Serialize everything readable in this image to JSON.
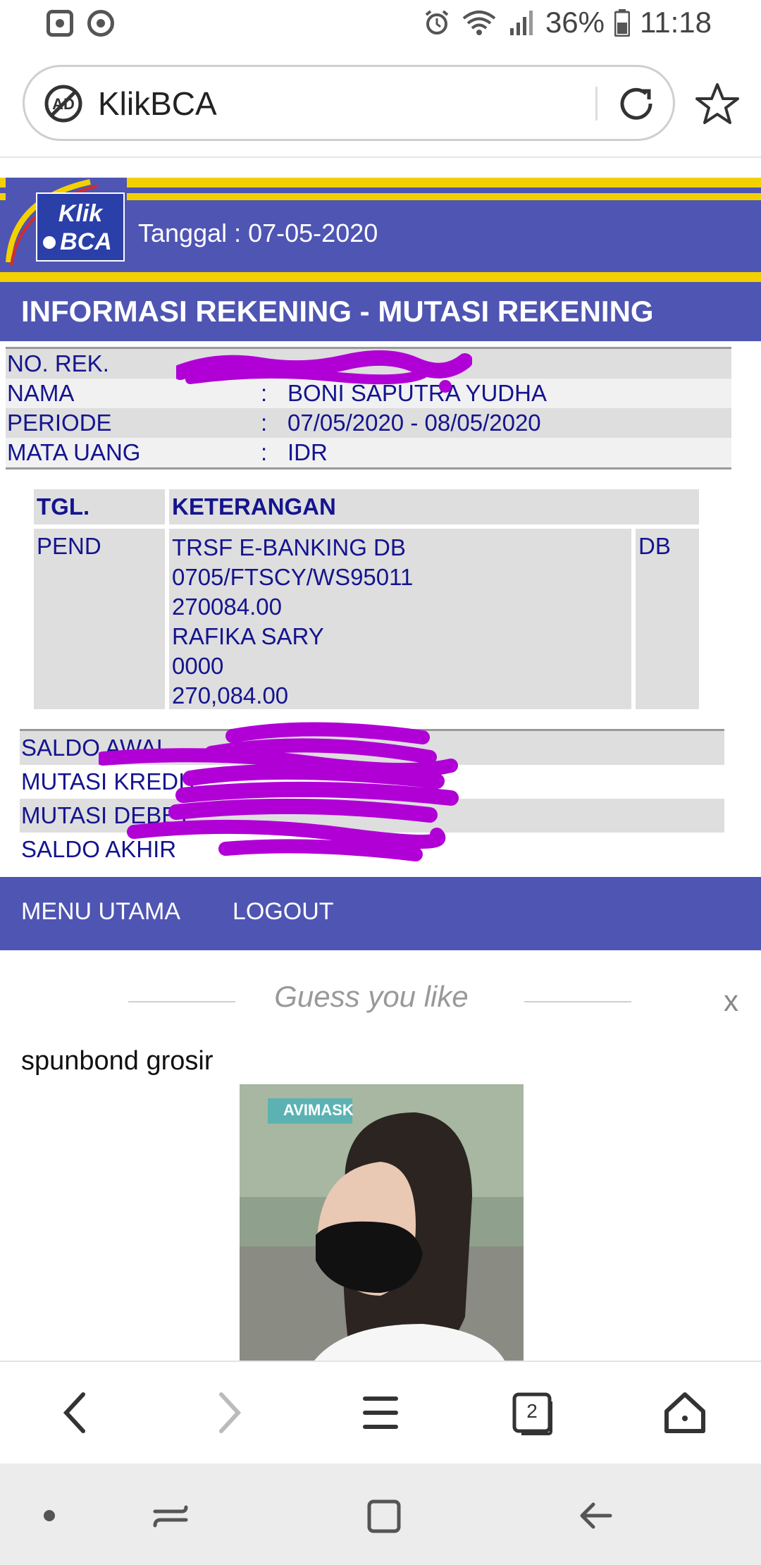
{
  "status_bar": {
    "battery": "36%",
    "time": "11:18"
  },
  "browser": {
    "url_title": "KlikBCA",
    "tab_count": "2"
  },
  "header": {
    "tanggal": "Tanggal : 07-05-2020",
    "title": "INFORMASI REKENING - MUTASI REKENING"
  },
  "info": {
    "norek_label": "NO. REK.",
    "norek_value": "",
    "nama_label": "NAMA",
    "nama_value": "BONI SAPUTRA YUDHA",
    "periode_label": "PERIODE",
    "periode_value": "07/05/2020 - 08/05/2020",
    "mata_uang_label": "MATA UANG",
    "mata_uang_value": "IDR",
    "colon": ":"
  },
  "mutasi": {
    "col_tgl": "TGL.",
    "col_ket": "KETERANGAN",
    "rows": [
      {
        "tgl": "PEND",
        "lines": [
          "TRSF E-BANKING DB",
          "0705/FTSCY/WS95011",
          "270084.00",
          "RAFIKA SARY",
          "0000",
          "270,084.00"
        ],
        "type": "DB"
      }
    ]
  },
  "saldo": {
    "awal": "SALDO AWAL",
    "kredit": "MUTASI KREDIT",
    "debet": "MUTASI DEBET",
    "akhir": "SALDO AKHIR"
  },
  "menu": {
    "main": "MENU UTAMA",
    "logout": "LOGOUT"
  },
  "recommend": {
    "header": "Guess you like",
    "close": "x",
    "item_title": "spunbond grosir",
    "image_brand": "AVIMASK"
  },
  "colors": {
    "bca_blue": "#4f55b3",
    "bca_yellow": "#f3d100",
    "text_navy": "#14148f",
    "scribble": "#b000d6"
  }
}
